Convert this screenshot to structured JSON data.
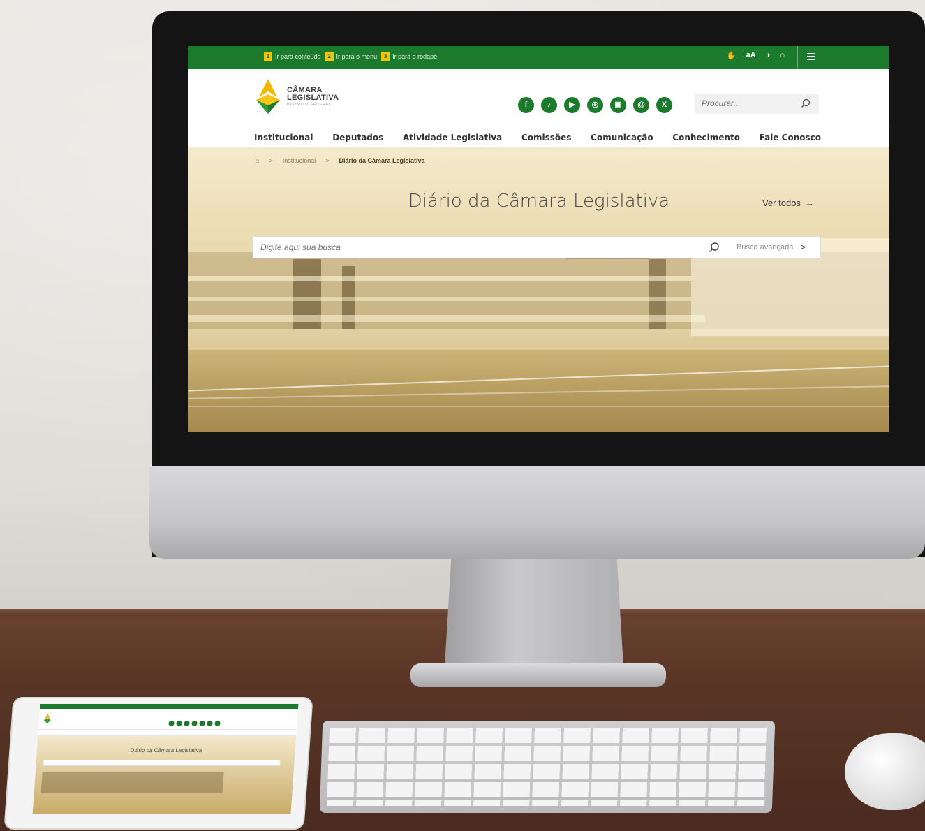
{
  "screen": {
    "skip_links": [
      {
        "num": "1",
        "label": "Ir para conteúdo"
      },
      {
        "num": "2",
        "label": "Ir para o menu"
      },
      {
        "num": "3",
        "label": "Ir para o rodapé"
      }
    ],
    "a11y": {
      "libras": "✋",
      "font_size": "aA",
      "contrast": "◑",
      "lock": "⌂"
    },
    "logo": {
      "line1": "CÂMARA",
      "line2": "LEGISLATIVA",
      "line3": "DISTRITO FEDERAL"
    },
    "socials": [
      {
        "name": "facebook-icon",
        "glyph": "f"
      },
      {
        "name": "tiktok-icon",
        "glyph": "♪"
      },
      {
        "name": "youtube-icon",
        "glyph": "▶"
      },
      {
        "name": "instagram-icon",
        "glyph": "◎"
      },
      {
        "name": "flickr-icon",
        "glyph": "▣"
      },
      {
        "name": "threads-icon",
        "glyph": "@"
      },
      {
        "name": "x-icon",
        "glyph": "X"
      }
    ],
    "site_search": {
      "placeholder": "Procurar..."
    },
    "nav": [
      "Institucional",
      "Deputados",
      "Atividade Legislativa",
      "Comissões",
      "Comunicação",
      "Conhecimento",
      "Fale Conosco"
    ],
    "breadcrumb": {
      "home_icon": "⌂",
      "sep": ">",
      "level1": "Institucional",
      "current": "Diário da Câmara Legislativa"
    },
    "hero": {
      "title": "Diário da Câmara Legislativa",
      "see_all": "Ver todos",
      "see_all_arrow": "→",
      "search_placeholder": "Digite aqui sua busca",
      "advanced": "Busca avançada",
      "advanced_chevron": ">"
    }
  },
  "tablet": {
    "title": "Diário da Câmara Legislativa"
  },
  "colors": {
    "brand_green": "#1b7a2c",
    "skip_num_bg": "#f1c40f",
    "hero_tint": "#e8d6a6"
  }
}
